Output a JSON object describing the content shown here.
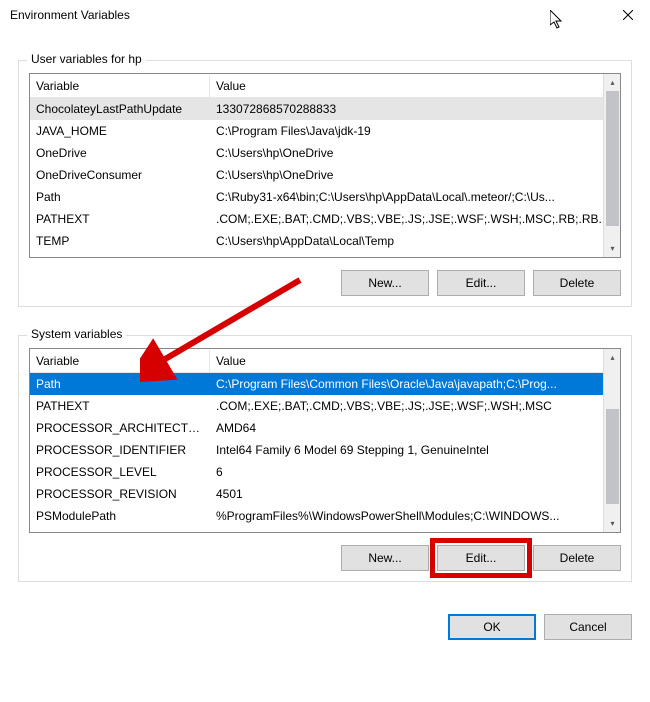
{
  "window": {
    "title": "Environment Variables"
  },
  "userVars": {
    "label": "User variables for hp",
    "columns": {
      "variable": "Variable",
      "value": "Value"
    },
    "rows": [
      {
        "variable": "ChocolateyLastPathUpdate",
        "value": "133072868570288833",
        "highlighted": true
      },
      {
        "variable": "JAVA_HOME",
        "value": "C:\\Program Files\\Java\\jdk-19"
      },
      {
        "variable": "OneDrive",
        "value": "C:\\Users\\hp\\OneDrive"
      },
      {
        "variable": "OneDriveConsumer",
        "value": "C:\\Users\\hp\\OneDrive"
      },
      {
        "variable": "Path",
        "value": "C:\\Ruby31-x64\\bin;C:\\Users\\hp\\AppData\\Local\\.meteor/;C:\\Us..."
      },
      {
        "variable": "PATHEXT",
        "value": ".COM;.EXE;.BAT;.CMD;.VBS;.VBE;.JS;.JSE;.WSF;.WSH;.MSC;.RB;.RB..."
      },
      {
        "variable": "TEMP",
        "value": "C:\\Users\\hp\\AppData\\Local\\Temp"
      }
    ],
    "buttons": {
      "new": "New...",
      "edit": "Edit...",
      "delete": "Delete"
    }
  },
  "systemVars": {
    "label": "System variables",
    "columns": {
      "variable": "Variable",
      "value": "Value"
    },
    "rows": [
      {
        "variable": "Path",
        "value": "C:\\Program Files\\Common Files\\Oracle\\Java\\javapath;C:\\Prog...",
        "selected": true
      },
      {
        "variable": "PATHEXT",
        "value": ".COM;.EXE;.BAT;.CMD;.VBS;.VBE;.JS;.JSE;.WSF;.WSH;.MSC"
      },
      {
        "variable": "PROCESSOR_ARCHITECTU...",
        "value": "AMD64"
      },
      {
        "variable": "PROCESSOR_IDENTIFIER",
        "value": "Intel64 Family 6 Model 69 Stepping 1, GenuineIntel"
      },
      {
        "variable": "PROCESSOR_LEVEL",
        "value": "6"
      },
      {
        "variable": "PROCESSOR_REVISION",
        "value": "4501"
      },
      {
        "variable": "PSModulePath",
        "value": "%ProgramFiles%\\WindowsPowerShell\\Modules;C:\\WINDOWS..."
      }
    ],
    "buttons": {
      "new": "New...",
      "edit": "Edit...",
      "delete": "Delete"
    }
  },
  "dialogButtons": {
    "ok": "OK",
    "cancel": "Cancel"
  }
}
